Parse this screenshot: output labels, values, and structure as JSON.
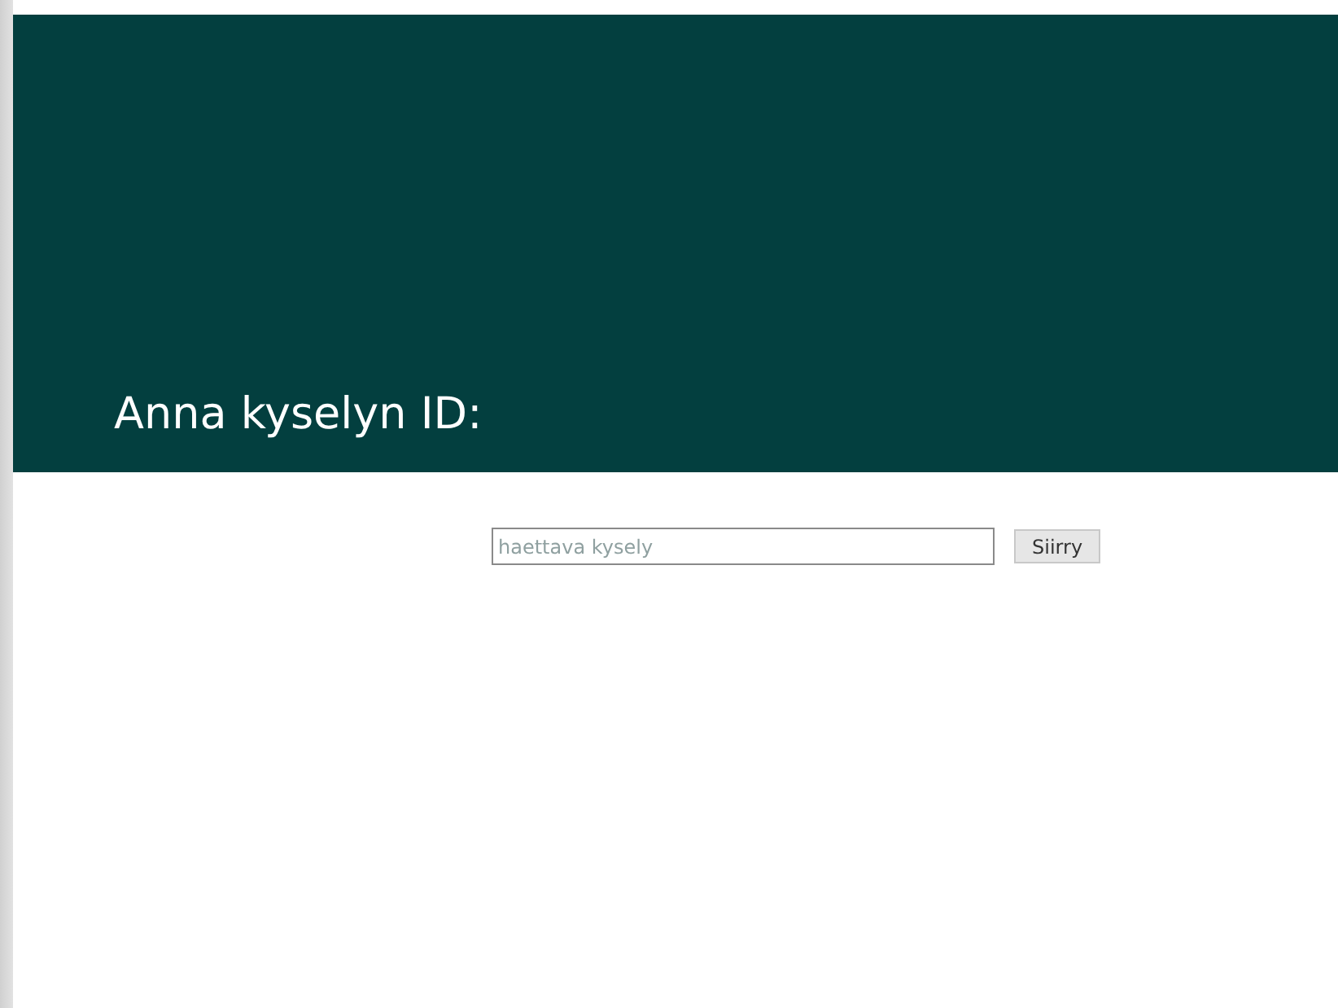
{
  "header": {
    "title": "Anna kyselyn ID:"
  },
  "search": {
    "placeholder": "haettava kysely",
    "button": "Siirry"
  }
}
